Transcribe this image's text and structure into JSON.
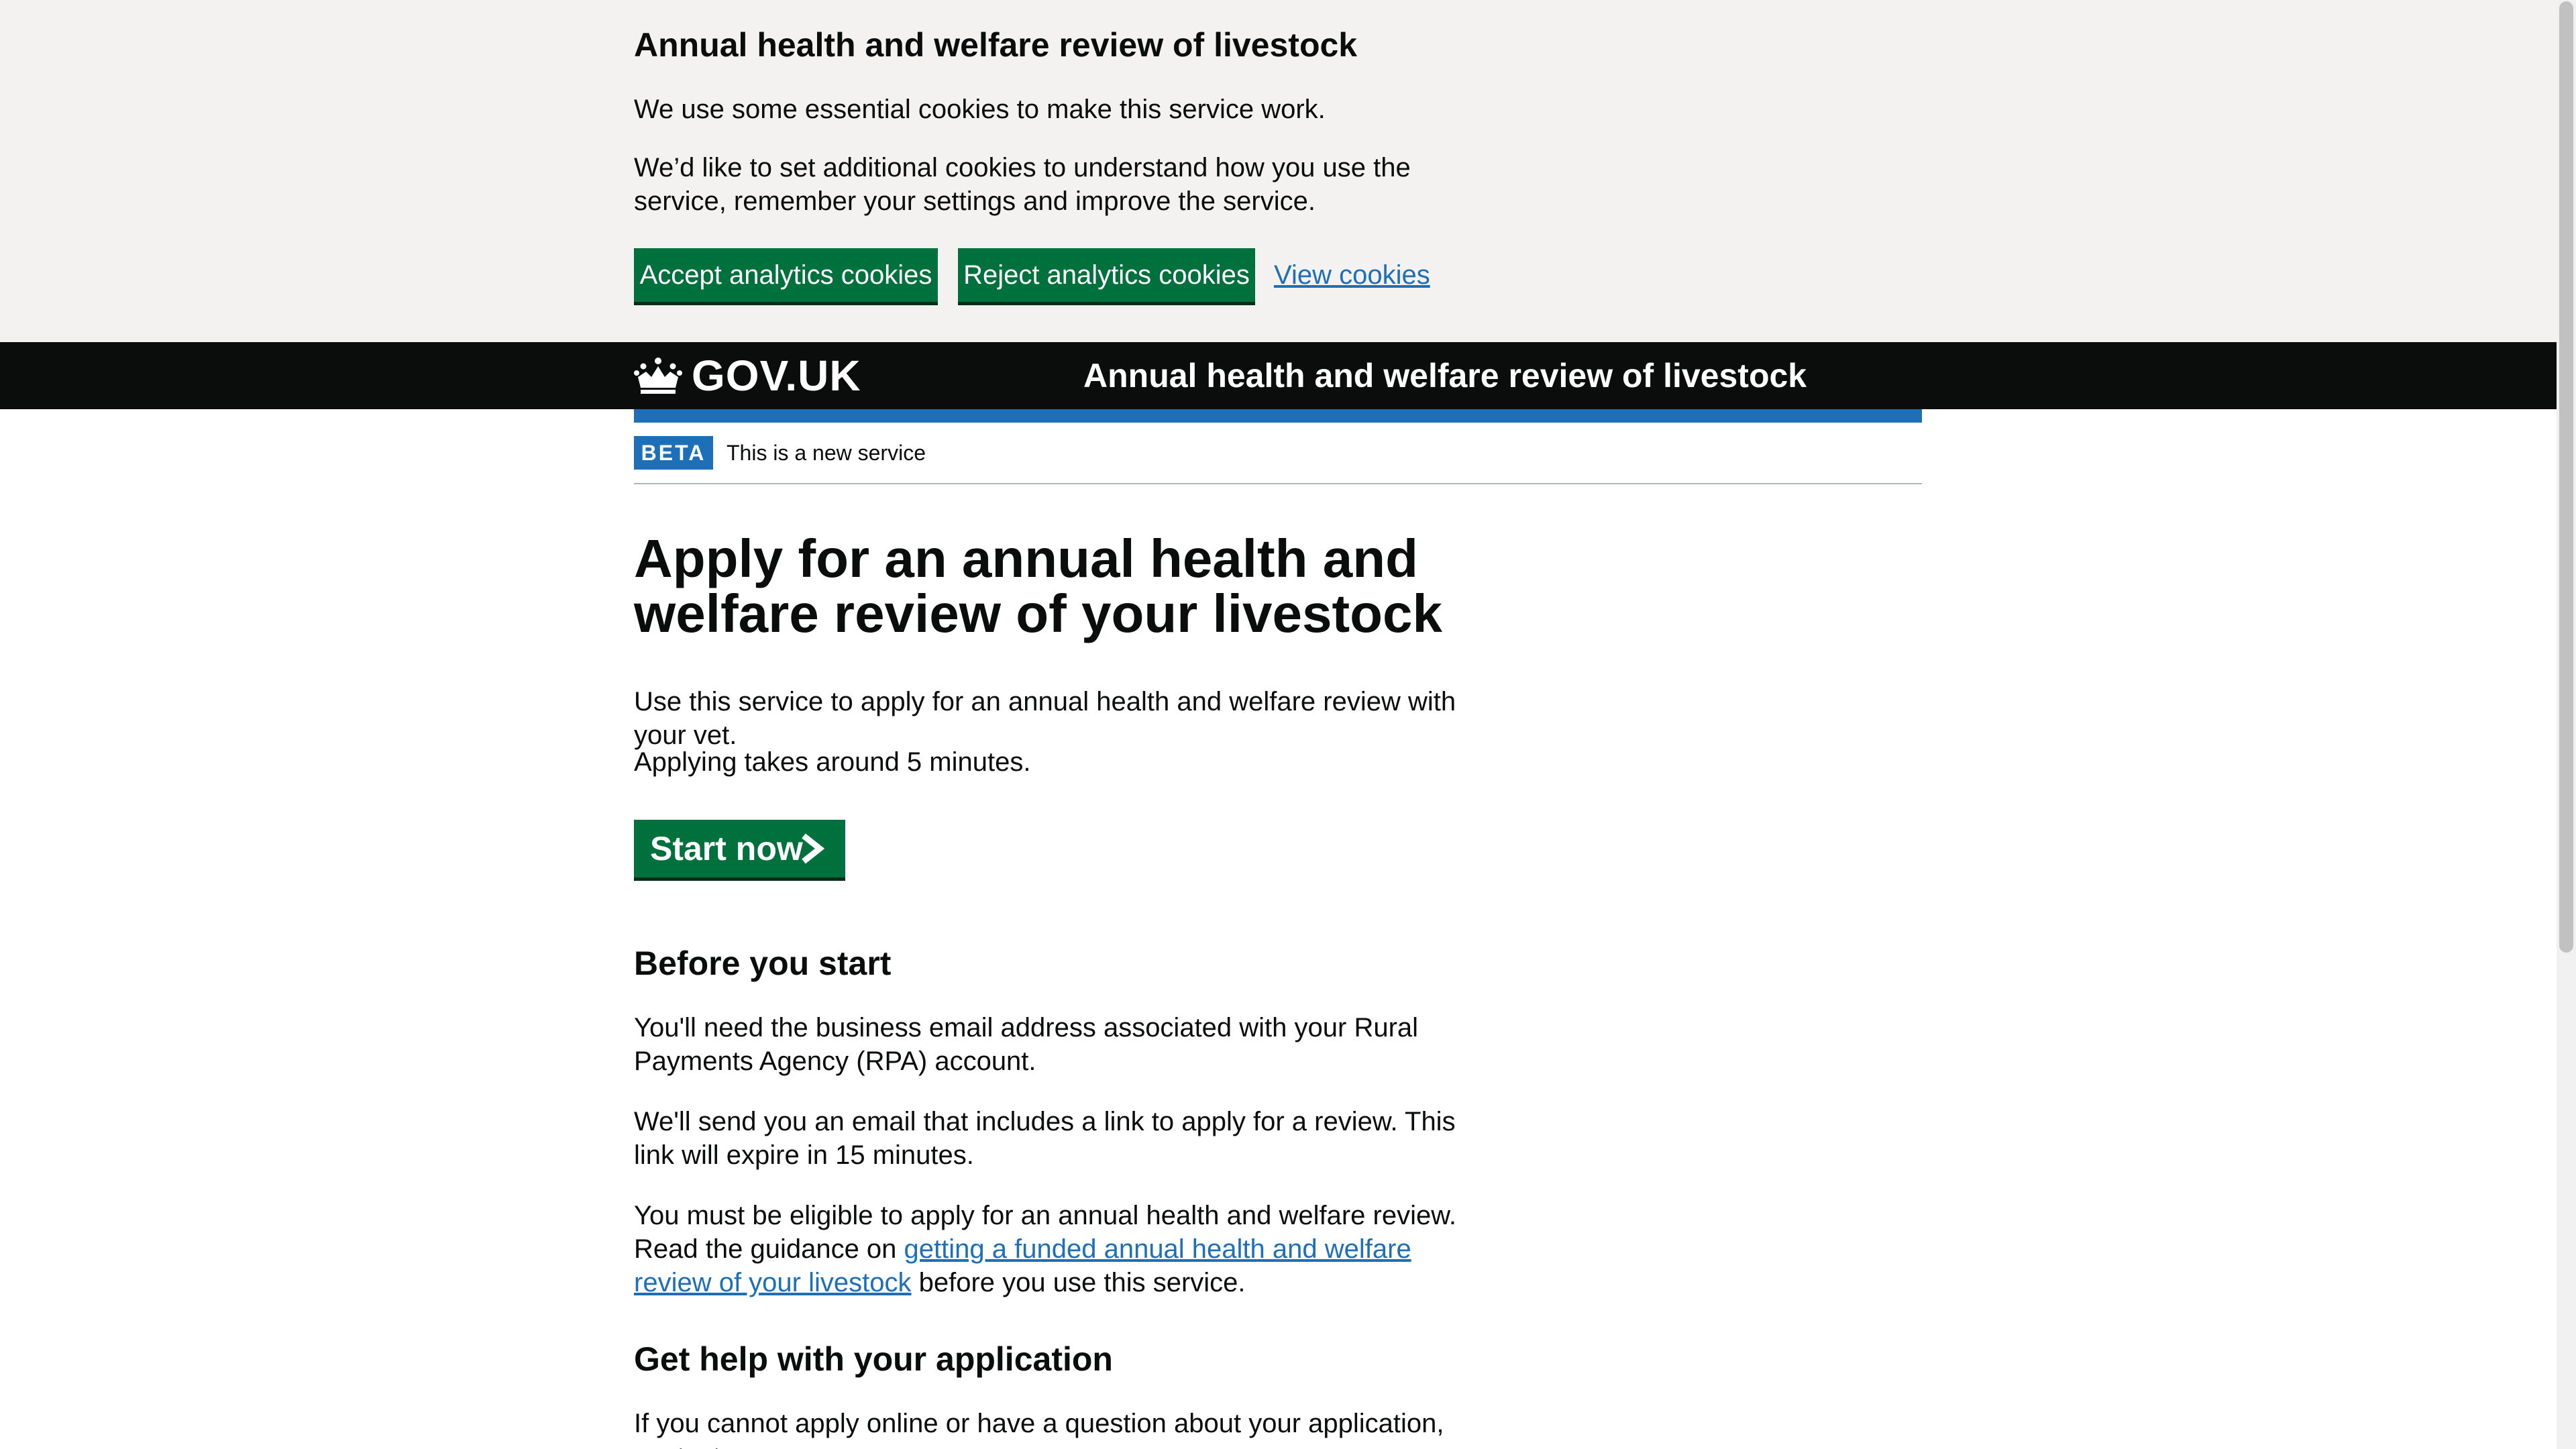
{
  "cookie_banner": {
    "title": "Annual health and welfare review of livestock",
    "p1": "We use some essential cookies to make this service work.",
    "p2": "We’d like to set additional cookies to understand how you use the service, remember your settings and improve the service.",
    "accept_label": "Accept analytics cookies",
    "reject_label": "Reject analytics cookies",
    "view_label": "View cookies"
  },
  "header": {
    "logo_text": "GOV.UK",
    "service_name": "Annual health and welfare review of livestock"
  },
  "phase_banner": {
    "tag": "BETA",
    "text": "This is a new service"
  },
  "main": {
    "title": "Apply for an annual health and welfare review of your livestock",
    "intro": "Use this service to apply for an annual health and welfare review with your vet.",
    "duration": "Applying takes around 5 minutes.",
    "start_label": "Start now",
    "before_heading": "Before you start",
    "before_p1": "You'll need the business email address associated with your Rural Payments Agency (RPA) account.",
    "before_p2": "We'll send you an email that includes a link to apply for a review. This link will expire in 15 minutes.",
    "before_p3_start": "You must be eligible to apply for an annual health and welfare review. Read the guidance on ",
    "before_p3_link": "getting a funded annual health and welfare review of your livestock",
    "before_p3_end": " before you use this service.",
    "help_heading": "Get help with your application",
    "help_p1": "If you cannot apply online or have a question about your application, contact"
  },
  "colors": {
    "banner_bg": "#f3f2f1",
    "button_green": "#00703c",
    "header_black": "#0b0c0c",
    "link_blue": "#1d70b8",
    "tag_blue": "#1d70b8"
  },
  "icons": {
    "logo": "crown-icon",
    "start": "chevron-right-icon"
  }
}
